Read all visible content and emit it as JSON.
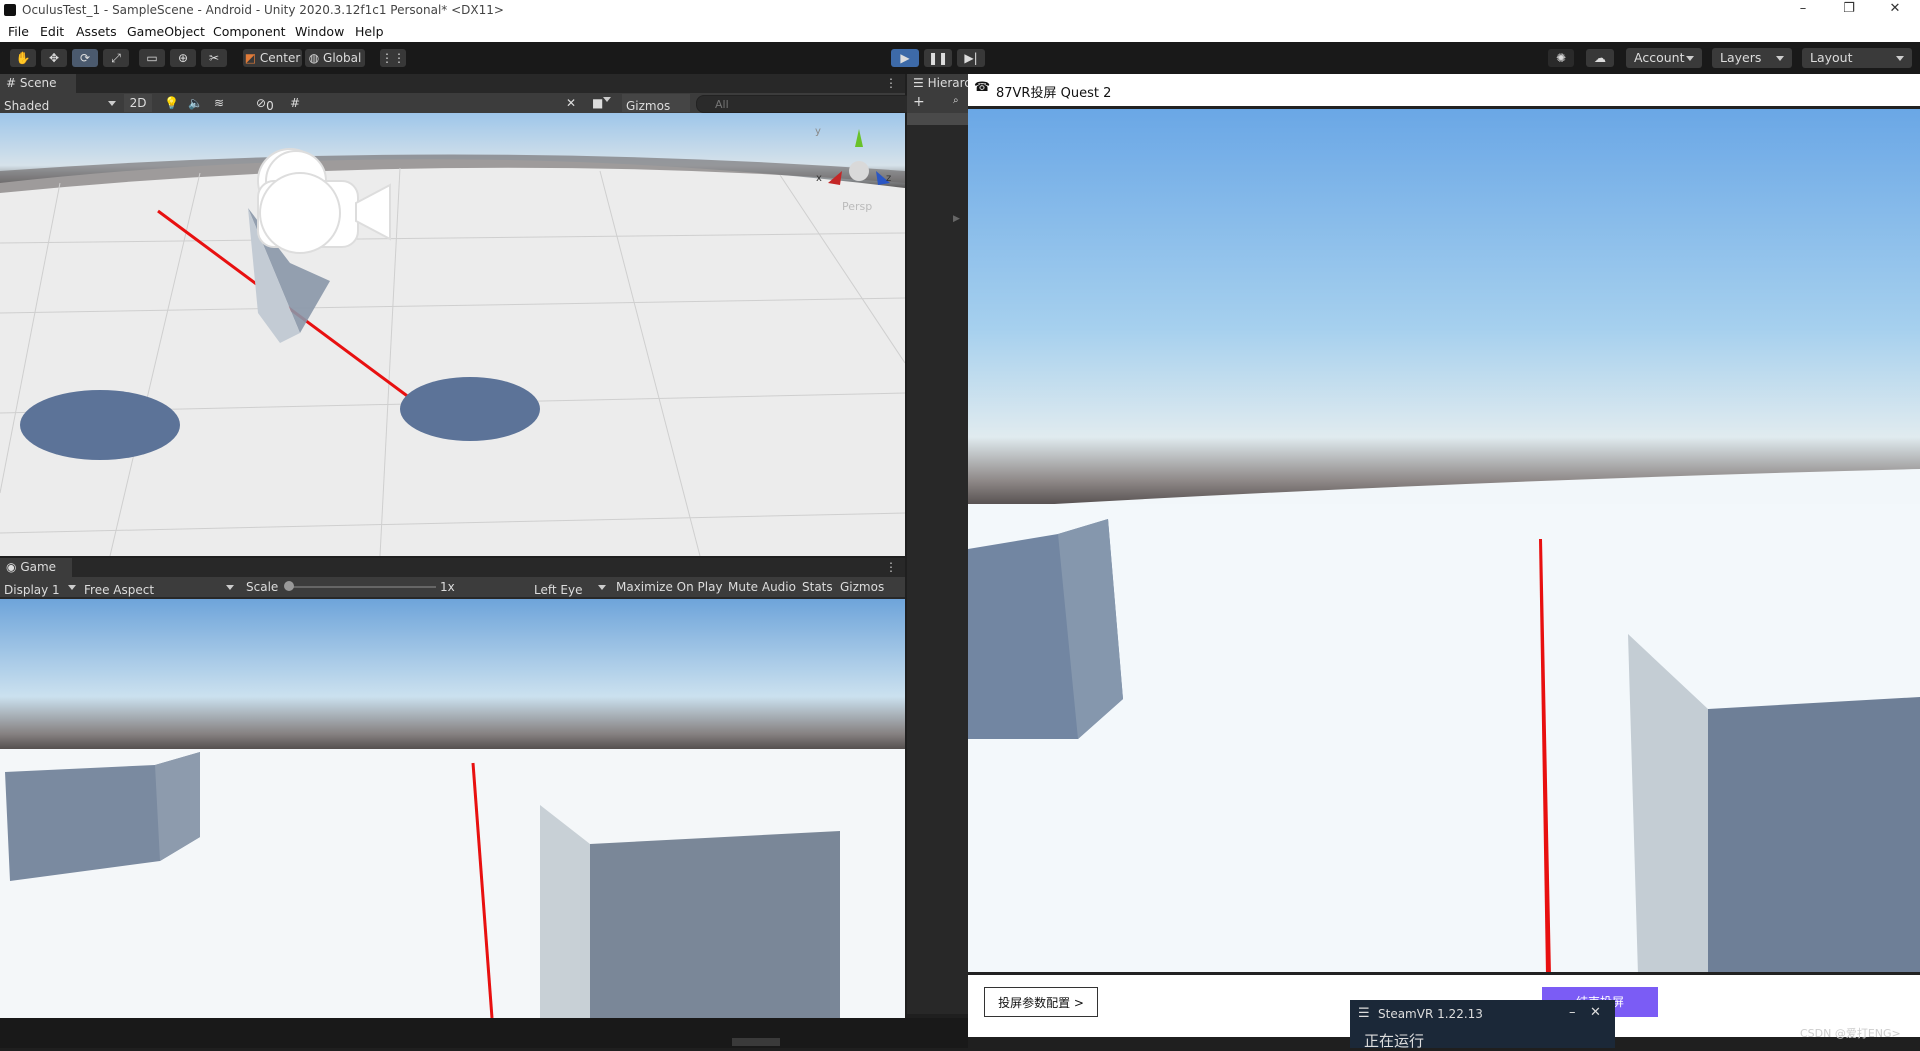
{
  "window": {
    "title": "OculusTest_1 - SampleScene - Android - Unity 2020.3.12f1c1 Personal* <DX11>"
  },
  "menu": [
    "File",
    "Edit",
    "Assets",
    "GameObject",
    "Component",
    "Window",
    "Help"
  ],
  "toolbar": {
    "pivot": "Center",
    "space": "Global",
    "account": "Account",
    "layers": "Layers",
    "layout": "Layout"
  },
  "scene": {
    "tab": "Scene",
    "shading": "Shaded",
    "mode2d": "2D",
    "hidden_count": "0",
    "gizmos": "Gizmos",
    "search_placeholder": "All",
    "persp": "Persp",
    "axis_x": "x",
    "axis_y": "y",
    "axis_z": "z"
  },
  "hierarchy": {
    "tab": "Hierarc"
  },
  "game": {
    "tab": "Game",
    "display": "Display 1",
    "aspect": "Free Aspect",
    "scale_label": "Scale",
    "scale_value": "1x",
    "eye": "Left Eye",
    "maximize": "Maximize On Play",
    "mute": "Mute Audio",
    "stats": "Stats",
    "gizmos": "Gizmos"
  },
  "vr": {
    "title": "87VR投屏 Quest 2",
    "config_button": "投屏参数配置 >",
    "end_button": "结束投屏",
    "accent": "#7b5cf5"
  },
  "steam": {
    "title": "SteamVR 1.22.13",
    "status": "正在运行"
  },
  "watermark": "CSDN @爱打ENG>"
}
